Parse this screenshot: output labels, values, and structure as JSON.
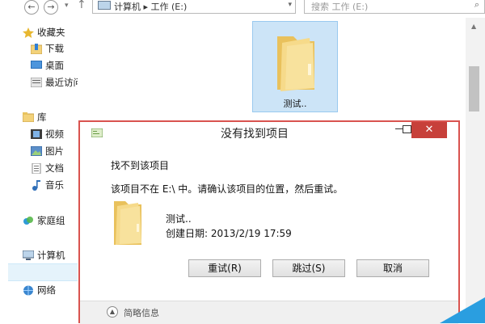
{
  "toolbar": {
    "address": "计算机 ▸ 工作 (E:)",
    "search_placeholder": "搜索 工作 (E:)"
  },
  "nav": {
    "favorites": {
      "header": "收藏夹",
      "items": [
        "下载",
        "桌面",
        "最近访问的位置"
      ]
    },
    "libraries": {
      "header": "库",
      "items": [
        "视频",
        "图片",
        "文档",
        "音乐"
      ]
    },
    "homegroup": "家庭组",
    "computer": "计算机",
    "network": "网络"
  },
  "content": {
    "folder_label": "测试.."
  },
  "dialog": {
    "title": "没有找到项目",
    "heading": "找不到该项目",
    "detail": "该项目不在 E:\\ 中。请确认该项目的位置，然后重试。",
    "file_name": "测试..",
    "file_date": "创建日期: 2013/2/19 17:59",
    "buttons": {
      "retry": "重试(R)",
      "skip": "跳过(S)",
      "cancel": "取消"
    },
    "details_label": "简略信息"
  },
  "colors": {
    "folder": "#f3d27a",
    "selection": "#cce4f7",
    "dialog_border": "#d9534f",
    "close_button": "#c7403a",
    "accent_corner": "#2a9ee0"
  },
  "icons": {
    "back": "left-arrow-icon",
    "forward": "right-arrow-icon",
    "up": "up-arrow-icon",
    "search": "magnifier-icon",
    "folder": "folder-icon"
  }
}
